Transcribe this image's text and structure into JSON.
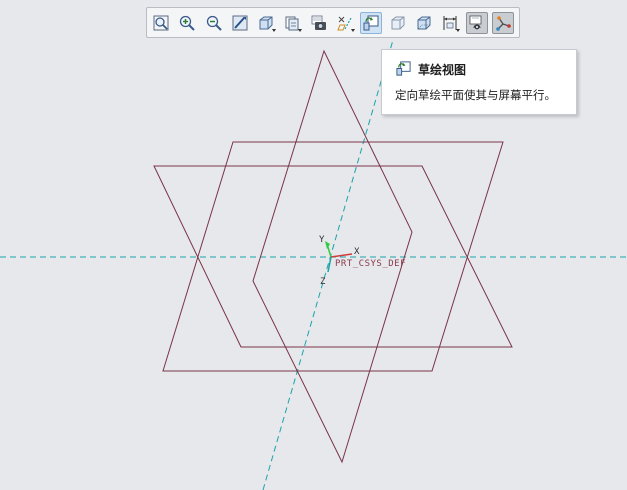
{
  "colors": {
    "background": "#e6e8ec",
    "plane_edges": "#7a3347",
    "axis_lines": "#1aa3a8",
    "toolbar_bg": "#f4f5f7",
    "active_button": "#cfe3f5"
  },
  "toolbar": {
    "buttons": [
      {
        "icon": "refit-icon"
      },
      {
        "icon": "zoom-in-icon"
      },
      {
        "icon": "zoom-out-icon"
      },
      {
        "icon": "repaint-icon"
      },
      {
        "icon": "saved-orientations-icon"
      },
      {
        "icon": "display-style-icon"
      },
      {
        "icon": "view-manager-icon"
      },
      {
        "icon": "datum-display-icon"
      },
      {
        "icon": "sketch-view-icon",
        "state": "active"
      },
      {
        "icon": "appearance-gallery-icon"
      },
      {
        "icon": "perspective-view-icon"
      },
      {
        "icon": "annotation-display-icon"
      },
      {
        "icon": "spin-center-icon",
        "state": "pressed"
      },
      {
        "icon": "csys-display-icon",
        "state": "pressed"
      }
    ]
  },
  "tooltip": {
    "title": "草绘视图",
    "description": "定向草绘平面使其与屏幕平行。"
  },
  "csys": {
    "name": "PRT_CSYS_DEF",
    "axis_x": "X",
    "axis_y": "Y",
    "axis_z": "Z"
  }
}
